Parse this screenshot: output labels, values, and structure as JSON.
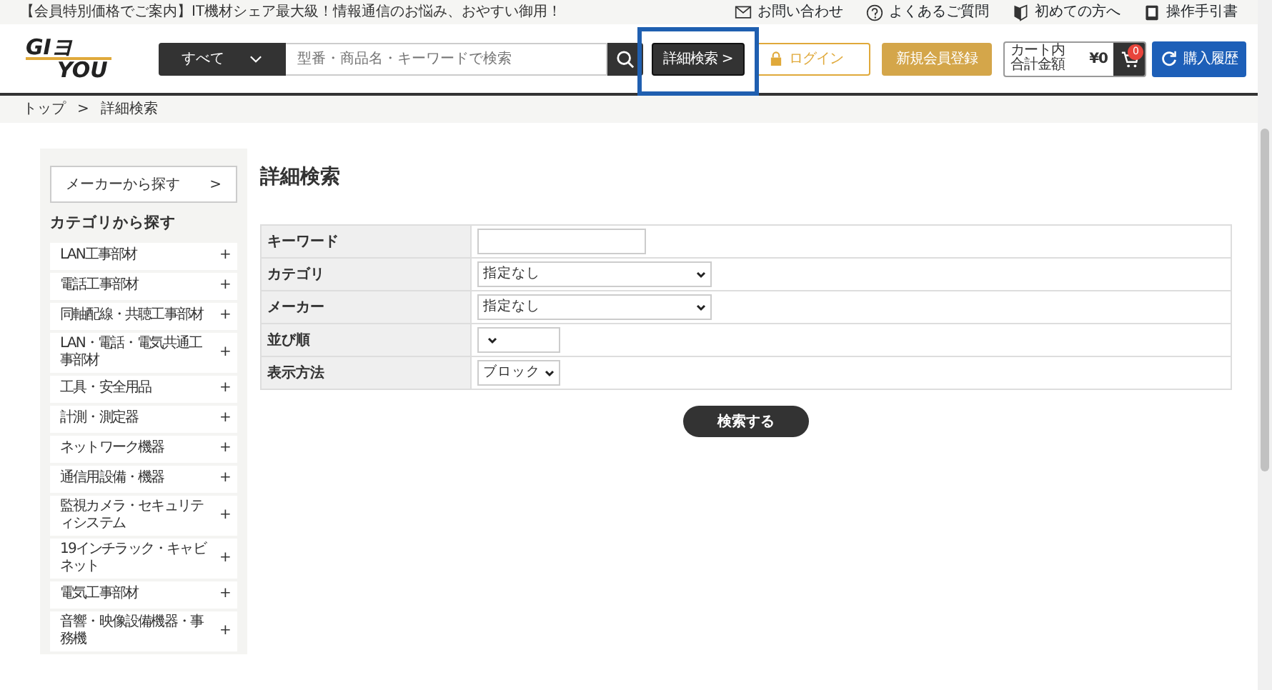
{
  "announcement": "【会員特別価格でご案内】IT機材シェア最大級！情報通信のお悩み、おやすい御用！",
  "top_links": [
    {
      "kind": "mail",
      "label": "お問い合わせ"
    },
    {
      "kind": "help",
      "label": "よくあるご質問"
    },
    {
      "kind": "beginner",
      "label": "初めての方へ"
    },
    {
      "kind": "manual",
      "label": "操作手引書"
    }
  ],
  "logo": {
    "line1": "GIヨ",
    "line2": "YOU"
  },
  "search": {
    "category": "すべて",
    "placeholder": "型番・商品名・キーワードで検索"
  },
  "header_buttons": [
    {
      "kind": "detail",
      "label": "詳細検索 >",
      "highlighted": true
    },
    {
      "kind": "login",
      "label": "ログイン",
      "highlighted": false
    },
    {
      "kind": "register",
      "label": "新規会員登録",
      "highlighted": false
    }
  ],
  "cart": {
    "label_1": "カート内",
    "label_2": "合計金額",
    "amount": "¥0",
    "badge": "0"
  },
  "history_button": "購入履歴",
  "breadcrumb": [
    "トップ",
    ">",
    "詳細検索"
  ],
  "sidebar": {
    "maker_link": "メーカーから探す",
    "maker_arrow": ">",
    "category_heading": "カテゴリから探す",
    "items": [
      "LAN工事部材",
      "電話工事部材",
      "同軸配線・共聴工事部材",
      "LAN・電話・電気共通工事部材",
      "工具・安全用品",
      "計測・測定器",
      "ネットワーク機器",
      "通信用設備・機器",
      "監視カメラ・セキュリティシステム",
      "19インチラック・キャビネット",
      "電気工事部材",
      "音響・映像設備機器・事務機"
    ],
    "expand_symbol": "+"
  },
  "page_title": "詳細検索",
  "form": [
    {
      "kind": "text",
      "label": "キーワード"
    },
    {
      "kind": "select",
      "label": "カテゴリ",
      "value": "指定なし"
    },
    {
      "kind": "select",
      "label": "メーカー",
      "value": "指定なし"
    },
    {
      "kind": "select",
      "label": "並び順"
    },
    {
      "kind": "select",
      "label": "表示方法",
      "value": "ブロック"
    }
  ],
  "submit": "検索する"
}
